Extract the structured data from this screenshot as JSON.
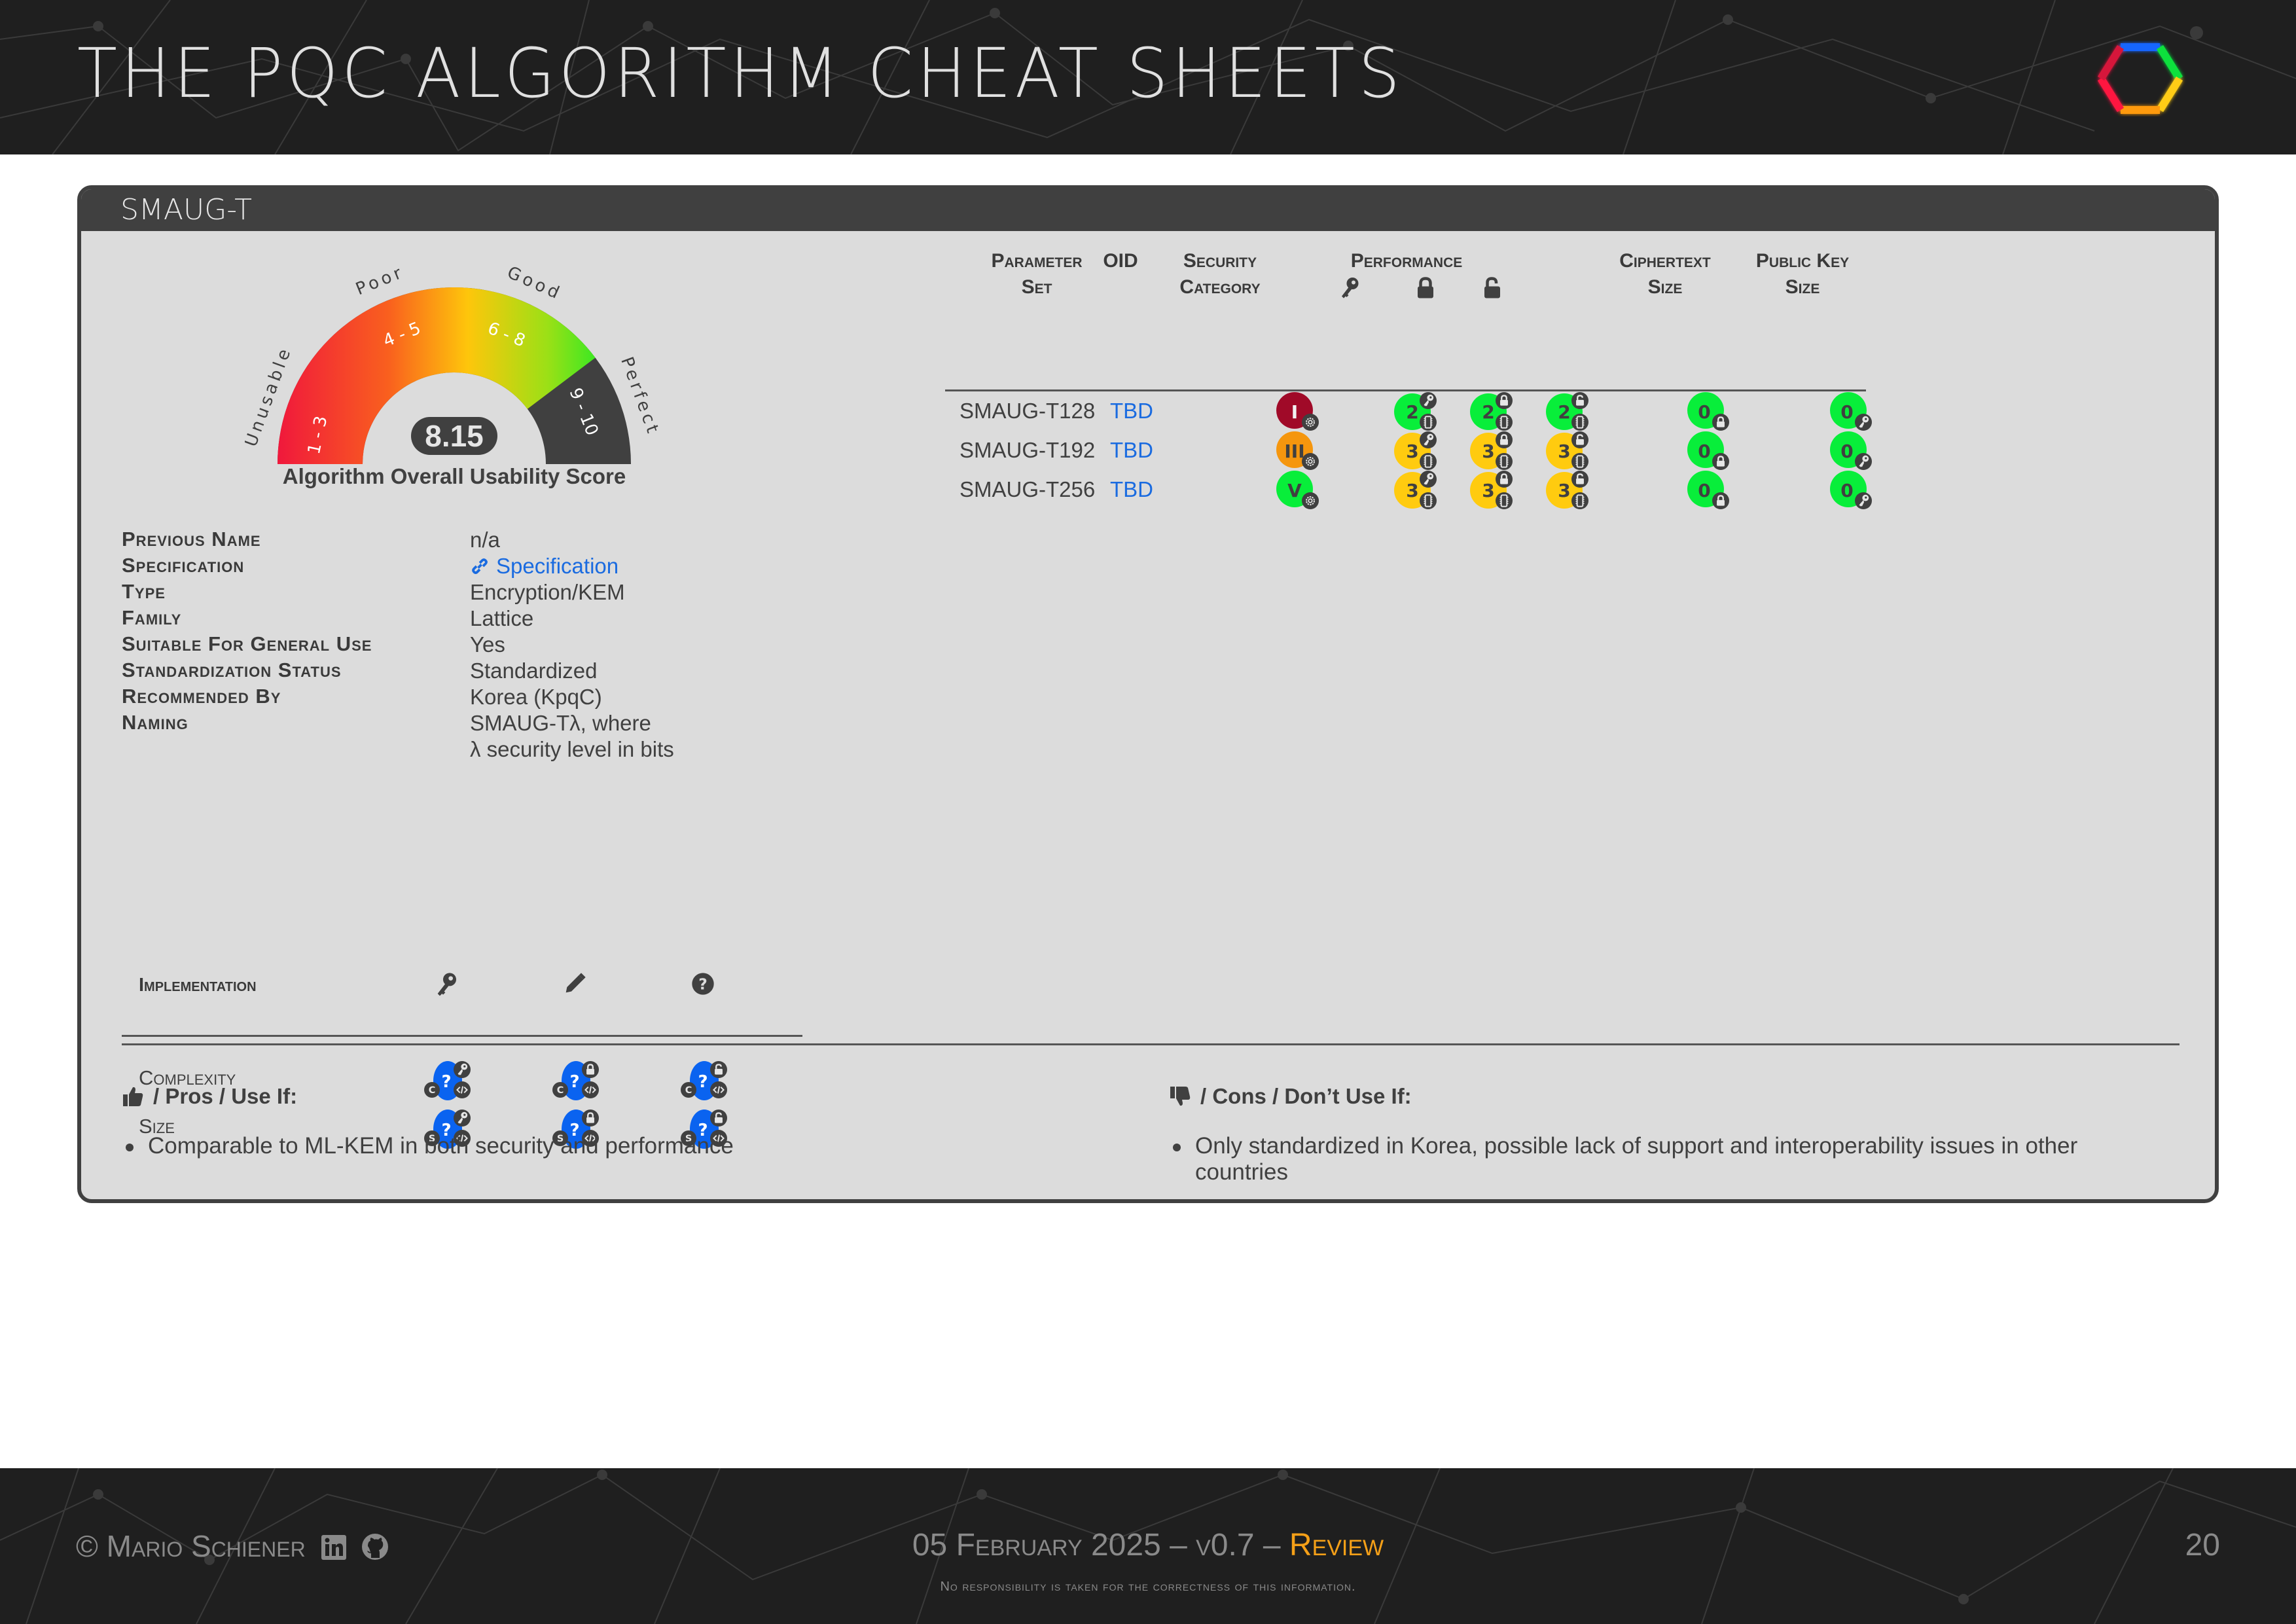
{
  "header": {
    "title": "THE PQC ALGORITHM CHEAT SHEETS",
    "logo_colors": [
      "#1466ff",
      "#11e03c",
      "#ffcc12",
      "#ff9a10",
      "#ff1540",
      "#d6133a"
    ]
  },
  "card": {
    "title": "SMAUG-T",
    "gauge": {
      "score": "8.15",
      "score_value": 8.15,
      "score_range": [
        1,
        10
      ],
      "caption": "Algorithm Overall Usability Score",
      "bands": [
        {
          "label": "Unusable",
          "range": "1 - 3"
        },
        {
          "label": "Poor",
          "range": "4 - 5"
        },
        {
          "label": "Good",
          "range": "6 - 8"
        },
        {
          "label": "Perfect",
          "range": "9 - 10"
        }
      ]
    },
    "info": [
      {
        "label": "Previous Name",
        "value": "n/a"
      },
      {
        "label": "Specification",
        "value": "Specification",
        "is_link": true,
        "icon": "link-icon"
      },
      {
        "label": "Type",
        "value": "Encryption/KEM"
      },
      {
        "label": "Family",
        "value": "Lattice"
      },
      {
        "label": "Suitable For General Use",
        "value": "Yes"
      },
      {
        "label": "Standardization Status",
        "value": "Standardized"
      },
      {
        "label": "Recommended By",
        "value": "Korea (KpqC)"
      },
      {
        "label": "Naming",
        "value": "SMAUG-Tλ, where",
        "value2": "λ security level in bits"
      }
    ],
    "implementation": {
      "title": "Implementation",
      "column_icons": [
        "key-icon",
        "pencil-icon",
        "question-circle-icon"
      ],
      "rows": [
        {
          "label": "Complexity",
          "letter": "C",
          "values": [
            "?",
            "?",
            "?"
          ],
          "sub_icons": [
            "key-icon",
            "lock-icon",
            "unlock-icon"
          ]
        },
        {
          "label": "Size",
          "letter": "S",
          "values": [
            "?",
            "?",
            "?"
          ],
          "sub_icons": [
            "key-icon",
            "lock-icon",
            "unlock-icon"
          ]
        }
      ],
      "unknown_color": "#0a63f0"
    },
    "parameters": {
      "headers": {
        "param_set": [
          "Parameter",
          "Set"
        ],
        "oid": "OID",
        "security": [
          "Security",
          "Category"
        ],
        "performance": "Performance",
        "performance_icons": [
          "key-icon",
          "lock-icon",
          "unlock-icon"
        ],
        "ciphertext": [
          "Ciphertext",
          "Size"
        ],
        "public_key": [
          "Public Key",
          "Size"
        ]
      },
      "rows": [
        {
          "name": "SMAUG-T128",
          "oid": "TBD",
          "security": "I",
          "security_color": "#a00a28",
          "perf": [
            {
              "v": "2",
              "c": "#08ee3a"
            },
            {
              "v": "2",
              "c": "#08ee3a"
            },
            {
              "v": "2",
              "c": "#08ee3a"
            }
          ],
          "ct": {
            "v": "0",
            "c": "#08ee3a"
          },
          "pk": {
            "v": "0",
            "c": "#08ee3a"
          }
        },
        {
          "name": "SMAUG-T192",
          "oid": "TBD",
          "security": "III",
          "security_color": "#f5960e",
          "perf": [
            {
              "v": "3",
              "c": "#ffcb0f"
            },
            {
              "v": "3",
              "c": "#ffcb0f"
            },
            {
              "v": "3",
              "c": "#ffcb0f"
            }
          ],
          "ct": {
            "v": "0",
            "c": "#08ee3a"
          },
          "pk": {
            "v": "0",
            "c": "#08ee3a"
          }
        },
        {
          "name": "SMAUG-T256",
          "oid": "TBD",
          "security": "V",
          "security_color": "#08ee3a",
          "perf": [
            {
              "v": "3",
              "c": "#ffcb0f"
            },
            {
              "v": "3",
              "c": "#ffcb0f"
            },
            {
              "v": "3",
              "c": "#ffcb0f"
            }
          ],
          "ct": {
            "v": "0",
            "c": "#08ee3a"
          },
          "pk": {
            "v": "0",
            "c": "#08ee3a"
          }
        }
      ]
    },
    "pros": {
      "title": "/ Pros / Use If:",
      "items": [
        "Comparable to ML-KEM in both security and performance"
      ]
    },
    "cons": {
      "title": "/ Cons / Don’t Use If:",
      "items": [
        "Only standardized in Korea, possible lack of support and interoperability issues in other countries"
      ]
    }
  },
  "footer": {
    "author": "© Mario Schiener",
    "date_version": "05 February 2025 – v0.7 – ",
    "status": "Review",
    "disclaimer": "No responsibility is taken for the correctness of this information.",
    "page": "20",
    "status_color": "#f5a018"
  }
}
